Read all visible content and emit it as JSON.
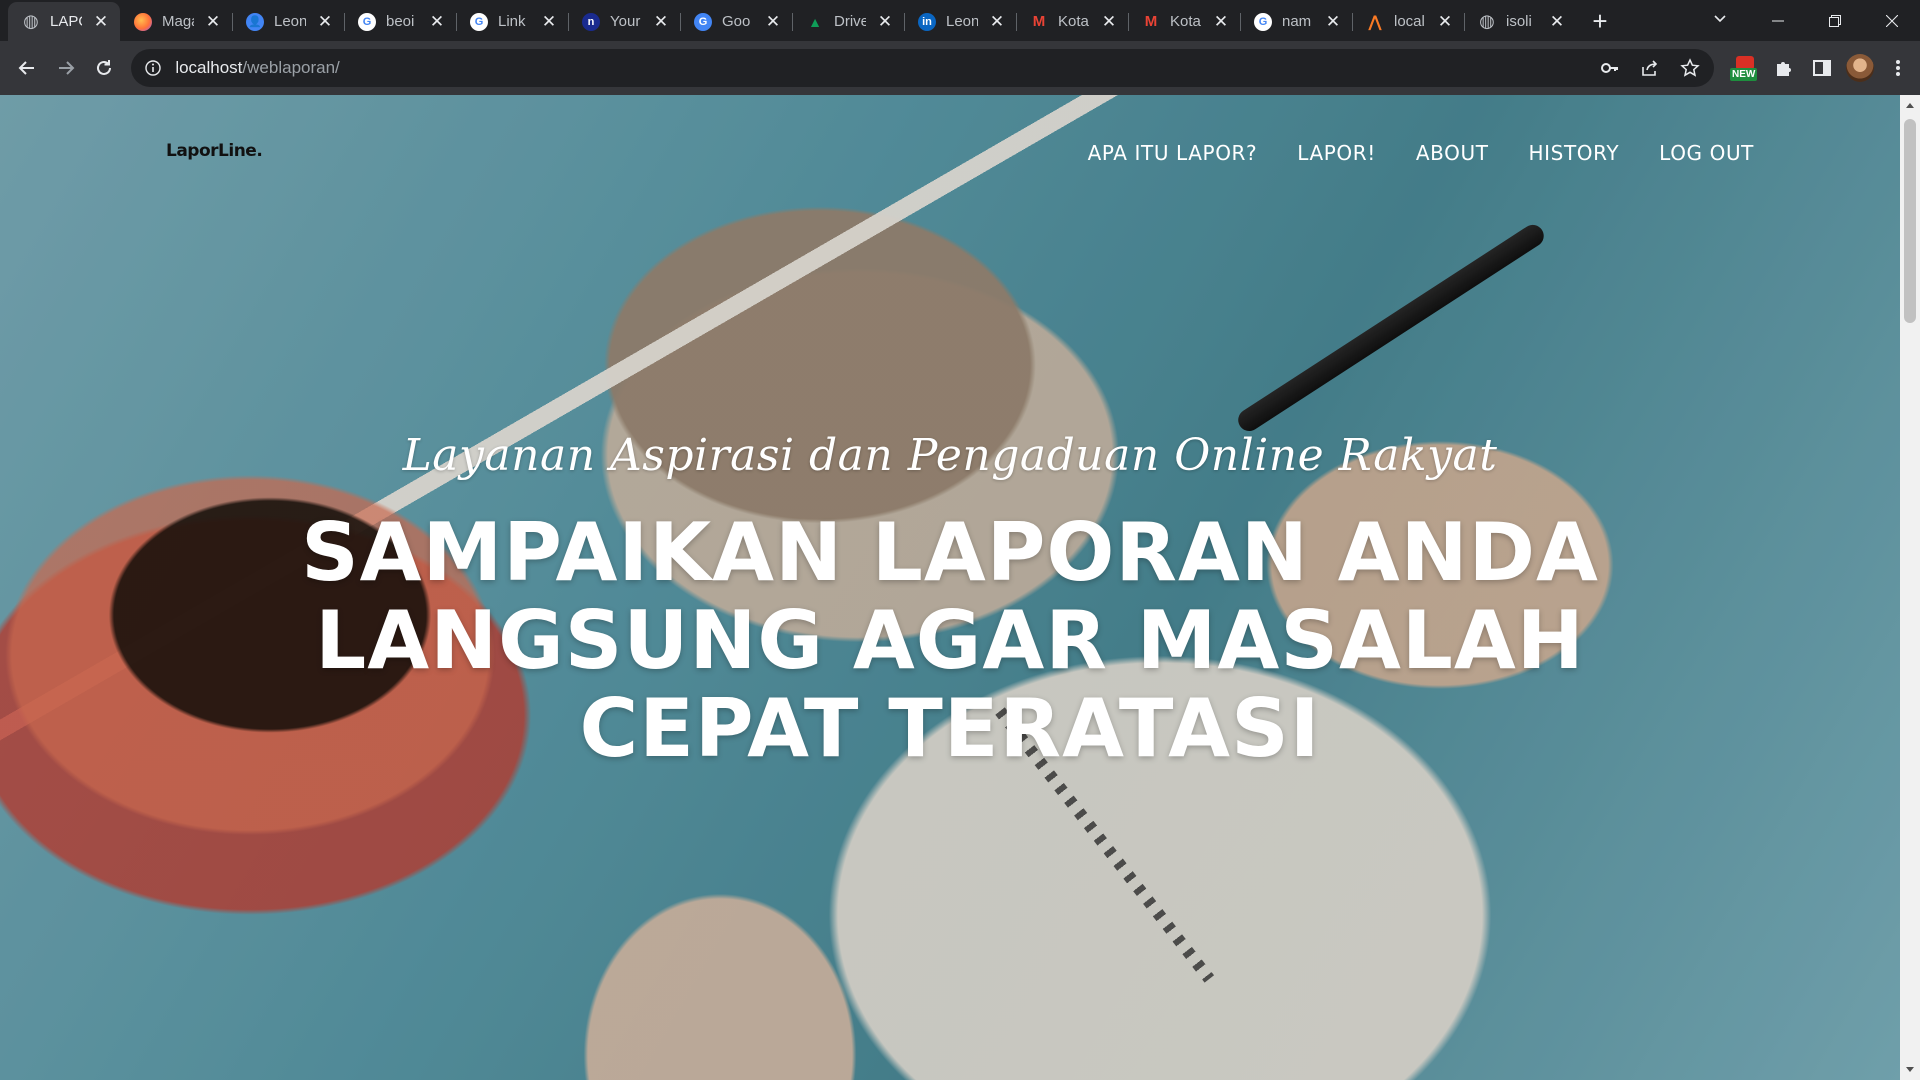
{
  "browser": {
    "tabs": [
      {
        "title": "LAPOR",
        "favicon": "globe-icon",
        "favicon_color": "#9aa0a6",
        "active": true
      },
      {
        "title": "Magang",
        "favicon": "firefox-icon",
        "favicon_color": "#ff7139",
        "active": false
      },
      {
        "title": "Leon",
        "favicon": "user-icon",
        "favicon_color": "#4285f4",
        "active": false
      },
      {
        "title": "beoi",
        "favicon": "google-icon",
        "favicon_color": "#ffffff",
        "active": false
      },
      {
        "title": "Link",
        "favicon": "google-icon",
        "favicon_color": "#ffffff",
        "active": false
      },
      {
        "title": "Your",
        "favicon": "n-icon",
        "favicon_color": "#1a2b8f",
        "active": false
      },
      {
        "title": "Goo",
        "favicon": "translate-icon",
        "favicon_color": "#4285f4",
        "active": false
      },
      {
        "title": "Drive",
        "favicon": "drive-icon",
        "favicon_color": "#0f9d58",
        "active": false
      },
      {
        "title": "Leon",
        "favicon": "linkedin-icon",
        "favicon_color": "#0a66c2",
        "active": false
      },
      {
        "title": "Kota",
        "favicon": "gmail-icon",
        "favicon_color": "#ea4335",
        "active": false
      },
      {
        "title": "Kota",
        "favicon": "gmail-icon",
        "favicon_color": "#ea4335",
        "active": false
      },
      {
        "title": "nam",
        "favicon": "google-icon",
        "favicon_color": "#ffffff",
        "active": false
      },
      {
        "title": "local",
        "favicon": "xampp-icon",
        "favicon_color": "#fb7a24",
        "active": false
      },
      {
        "title": "isoli",
        "favicon": "globe-icon",
        "favicon_color": "#9aa0a6",
        "active": false
      }
    ],
    "new_tab_label": "+",
    "close_glyph": "✕",
    "address": {
      "host": "localhost",
      "path": "/weblaporan/"
    },
    "extension_badge": "NEW"
  },
  "site": {
    "logo": "LaporLine.",
    "nav": [
      "APA ITU LAPOR?",
      "LAPOR!",
      "ABOUT",
      "HISTORY",
      "LOG OUT"
    ],
    "hero": {
      "subtitle": "Layanan Aspirasi dan Pengaduan Online Rakyat",
      "headline": "SAMPAIKAN LAPORAN ANDA LANGSUNG AGAR MASALAH CEPAT TERATASI"
    }
  },
  "colors": {
    "chrome_dark": "#202124",
    "chrome_toolbar": "#35363a",
    "hero_text": "#ffffff",
    "logo_text": "#111111"
  }
}
